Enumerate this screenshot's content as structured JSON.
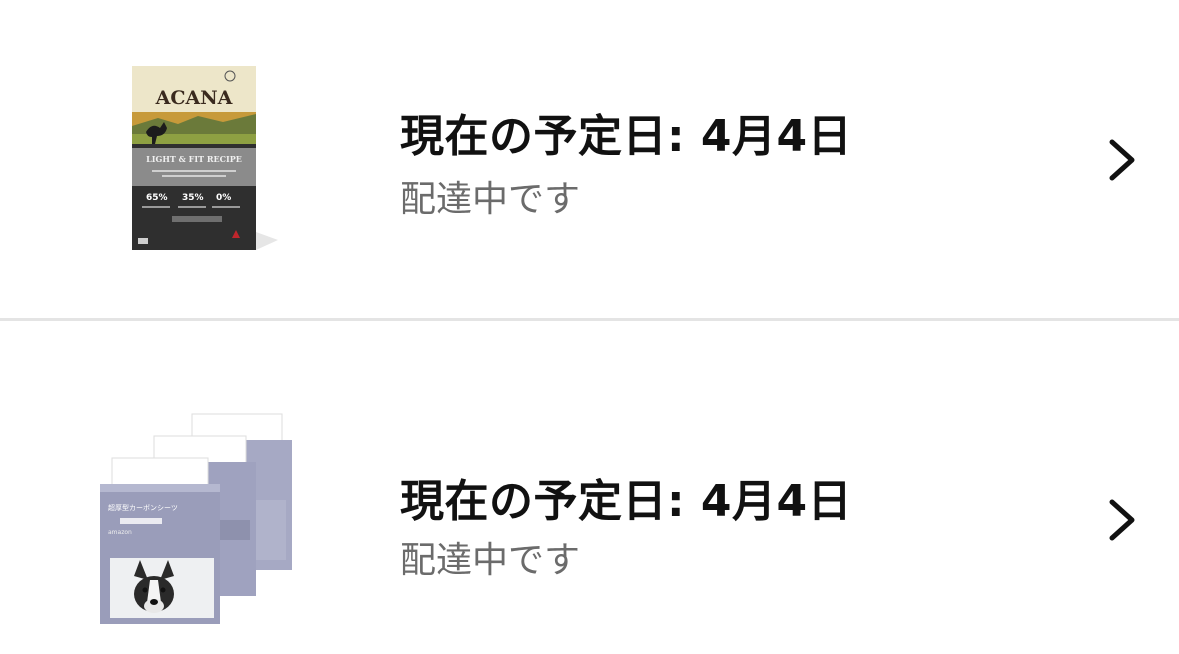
{
  "orders": [
    {
      "title": "現在の予定日: 4月4日",
      "status": "配達中です",
      "product_image": {
        "brand_text": "ACANA",
        "recipe_text": "LIGHT & FIT RECIPE",
        "stat_1": "65%",
        "stat_2": "35%",
        "stat_3": "0%"
      }
    },
    {
      "title": "現在の予定日: 4月4日",
      "status": "配達中です",
      "product_image": {
        "label_text": "超厚型カーボンシーツ",
        "brand_text": "amazon"
      }
    }
  ],
  "icons": {
    "chevron": "chevron-right-icon"
  },
  "colors": {
    "title": "#111111",
    "status": "#6b6b6b",
    "divider": "#e4e4e4"
  }
}
